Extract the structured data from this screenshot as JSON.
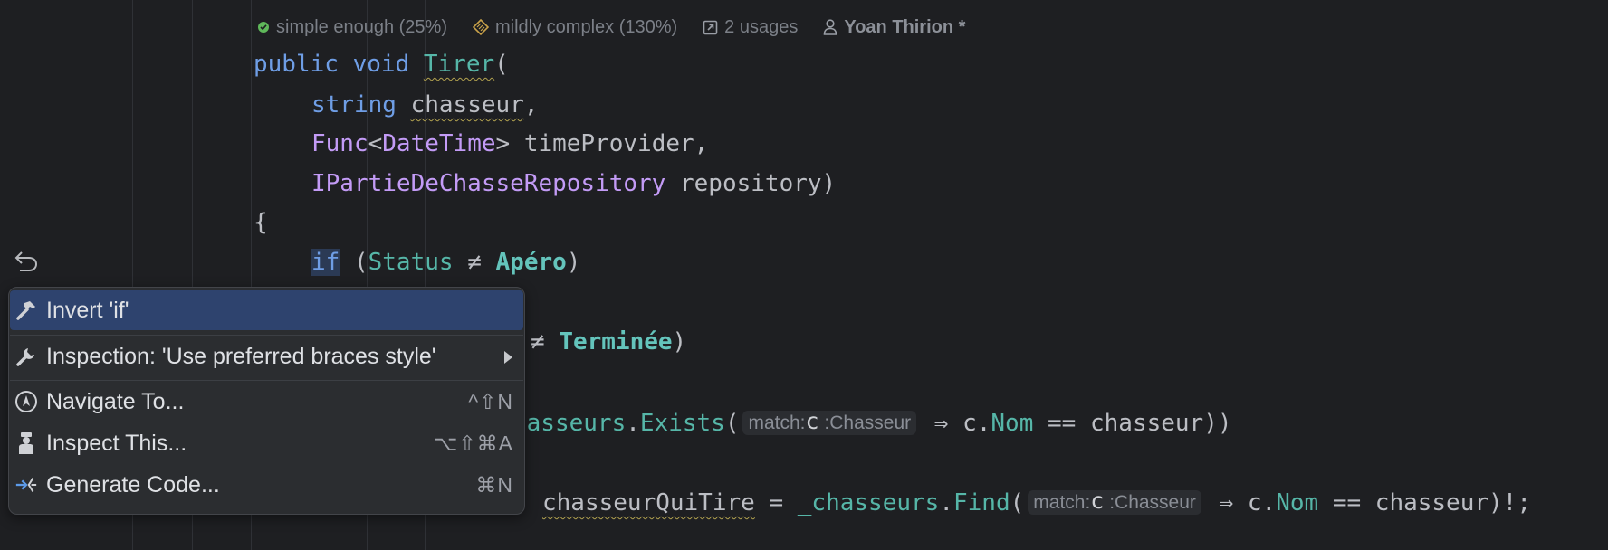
{
  "hints": {
    "complexity_simple": "simple enough (25%)",
    "complexity_mild": "mildly complex (130%)",
    "usages": "2 usages",
    "author": "Yoan Thirion *"
  },
  "code": {
    "l1_public": "public",
    "l1_void": "void",
    "l1_name": "Tirer",
    "l1_paren": "(",
    "l2_type": "string",
    "l2_param": "chasseur",
    "l2_comma": ",",
    "l3_func": "Func",
    "l3_lt": "<",
    "l3_dt": "DateTime",
    "l3_rest": "> timeProvider,",
    "l4_type": "IPartieDeChasseRepository",
    "l4_rest": " repository)",
    "l5_brace": "{",
    "l6_if": "if",
    "l6_open": " (",
    "l6_status": "Status",
    "l6_ne": " ≠ ",
    "l6_apero": "Apéro",
    "l6_close": ")",
    "l7_ne": "≠ ",
    "l7_terminee": "Terminée",
    "l7_close": ")",
    "l8_obj": "hasseurs",
    "l8_dot": ".",
    "l8_exists": "Exists",
    "l8_open": "(",
    "l8_inlay_label": "match:",
    "l8_inlay_var": "c",
    "l8_inlay_type": ":Chasseur",
    "l8_arrow": " ⇒ c.",
    "l8_nom": "Nom",
    "l8_rest": " == chasseur))",
    "l9_var": "chasseurQuiTire",
    "l9_eq": " = ",
    "l9_obj": "_chasseurs",
    "l9_dot": ".",
    "l9_find": "Find",
    "l9_open": "(",
    "l9_inlay_label": "match:",
    "l9_inlay_var": "c",
    "l9_inlay_type": ":Chasseur",
    "l9_arrow": " ⇒ c.",
    "l9_nom": "Nom",
    "l9_rest": " == chasseur)!;"
  },
  "menu": {
    "invert_if": "Invert 'if'",
    "inspection": "Inspection: 'Use preferred braces style'",
    "navigate": "Navigate To...",
    "navigate_shortcut": "^⇧N",
    "inspect": "Inspect This...",
    "inspect_shortcut": "⌥⇧⌘A",
    "generate": "Generate Code...",
    "generate_shortcut": "⌘N"
  },
  "colors": {
    "background": "#1e1f22",
    "selection": "#2e436e",
    "keyword": "#6f9ee6",
    "type": "#c39bf6",
    "method": "#56b6a8"
  }
}
